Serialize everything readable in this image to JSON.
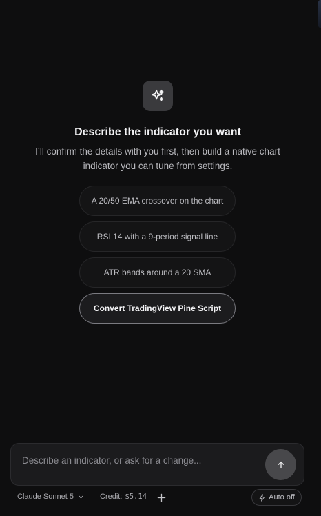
{
  "hero": {
    "icon": "sparkles-icon",
    "title": "Describe the indicator you want",
    "subtitle": "I’ll confirm the details with you first, then build a native chart indicator you can tune from settings."
  },
  "suggestions": [
    {
      "label": "A 20/50 EMA crossover on the chart"
    },
    {
      "label": "RSI 14 with a 9-period signal line"
    },
    {
      "label": "ATR bands around a 20 SMA"
    },
    {
      "label": "Convert TradingView Pine Script"
    }
  ],
  "composer": {
    "placeholder": "Describe an indicator, or ask for a change...",
    "value": "",
    "send_icon": "arrow-up-icon"
  },
  "footer": {
    "model": "Claude Sonnet 5",
    "credit_label": "Credit:",
    "credit_amount": "$5.14",
    "auto_label": "Auto off"
  },
  "colors": {
    "background": "#0e0e0f",
    "surface": "#1b1b1d",
    "send_button": "#48484b"
  }
}
